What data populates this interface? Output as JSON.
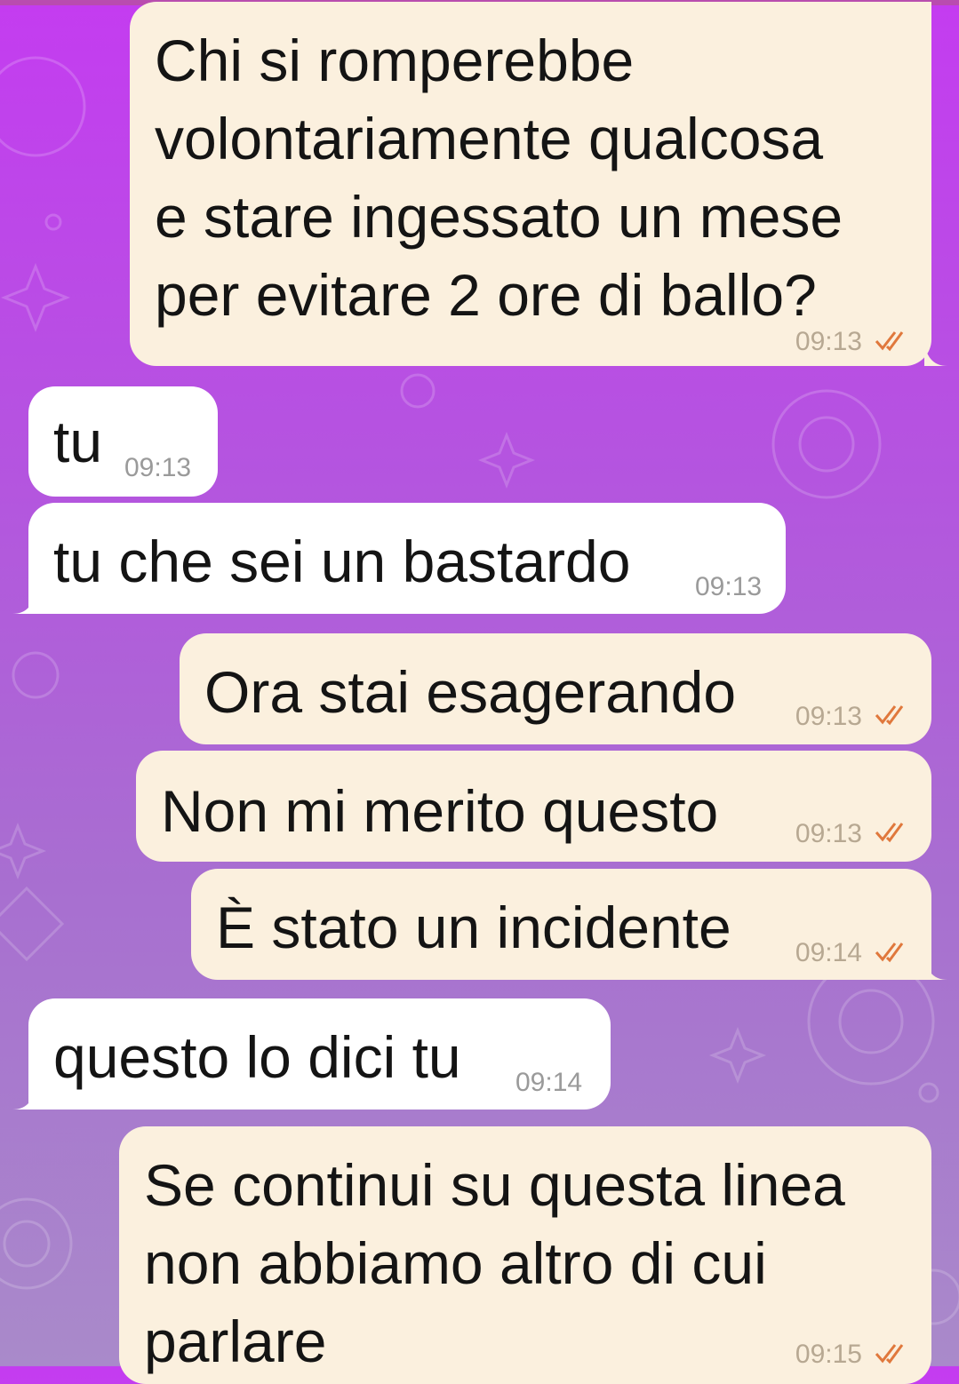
{
  "chat": {
    "messages": [
      {
        "text": "Chi si romperebbe\nvolontariamente qualcosa\ne stare ingessato un mese\nper evitare 2 ore di ballo?",
        "time": "09:13",
        "direction": "outgoing",
        "status": "read"
      },
      {
        "text": "tu",
        "time": "09:13",
        "direction": "incoming"
      },
      {
        "text": "tu che sei un bastardo",
        "time": "09:13",
        "direction": "incoming"
      },
      {
        "text": "Ora stai esagerando",
        "time": "09:13",
        "direction": "outgoing",
        "status": "read"
      },
      {
        "text": "Non mi merito questo",
        "time": "09:13",
        "direction": "outgoing",
        "status": "read"
      },
      {
        "text": "È stato un incidente",
        "time": "09:14",
        "direction": "outgoing",
        "status": "read"
      },
      {
        "text": "questo lo dici tu",
        "time": "09:14",
        "direction": "incoming"
      },
      {
        "text": "Se continui su questa linea\nnon abbiamo altro di cui\nparlare",
        "time": "09:15",
        "direction": "outgoing",
        "status": "read"
      }
    ]
  },
  "colors": {
    "outgoing_bubble": "#fbf0de",
    "incoming_bubble": "#ffffff",
    "read_check": "#e0783c",
    "background_top": "#c43cf0",
    "background_bottom": "#a98aca"
  }
}
